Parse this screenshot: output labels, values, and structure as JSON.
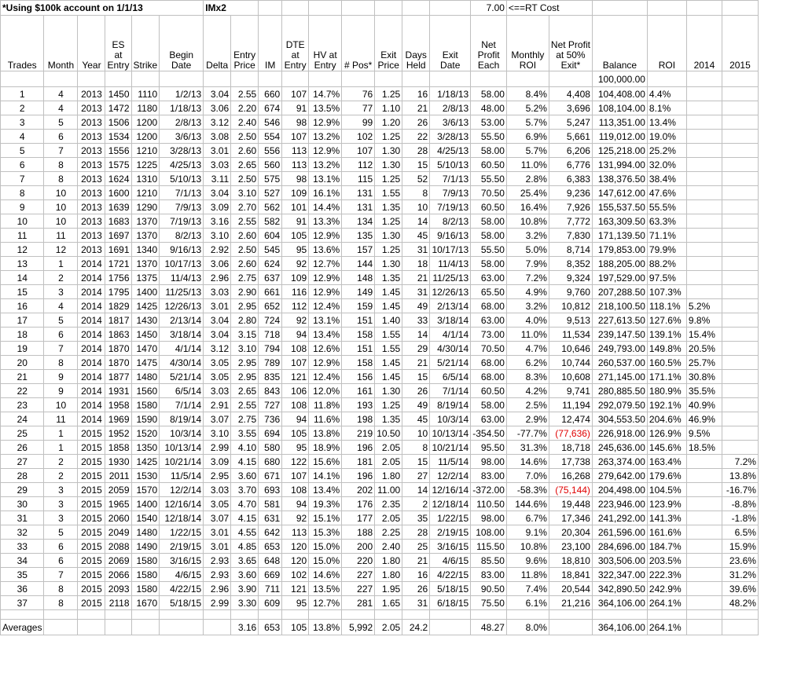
{
  "note": "*Using $100k account on 1/1/13",
  "im_note": "IMx2",
  "rt_cost": "7.00",
  "rt_cost_label": "<==RT Cost",
  "headers": [
    "Trades",
    "Month",
    "Year",
    "ES at Entry",
    "Strike",
    "Begin Date",
    "Delta",
    "Entry Price",
    "IM",
    "DTE at Entry",
    "HV at Entry",
    "# Pos*",
    "Exit Price",
    "Days Held",
    "Exit Date",
    "Net Profit Each",
    "Monthly ROI",
    "Net Profit at 50% Exit*",
    "Balance",
    "ROI",
    "2014",
    "2015"
  ],
  "starting_balance": "100,000.00",
  "rows": [
    [
      "1",
      "4",
      "2013",
      "1450",
      "1110",
      "1/2/13",
      "3.04",
      "2.55",
      "660",
      "107",
      "14.7%",
      "76",
      "1.25",
      "16",
      "1/18/13",
      "58.00",
      "8.4%",
      "4,408",
      "104,408.00",
      "4.4%",
      "",
      ""
    ],
    [
      "2",
      "4",
      "2013",
      "1472",
      "1180",
      "1/18/13",
      "3.06",
      "2.20",
      "674",
      "91",
      "13.5%",
      "77",
      "1.10",
      "21",
      "2/8/13",
      "48.00",
      "5.2%",
      "3,696",
      "108,104.00",
      "8.1%",
      "",
      ""
    ],
    [
      "3",
      "5",
      "2013",
      "1506",
      "1200",
      "2/8/13",
      "3.12",
      "2.40",
      "546",
      "98",
      "12.9%",
      "99",
      "1.20",
      "26",
      "3/6/13",
      "53.00",
      "5.7%",
      "5,247",
      "113,351.00",
      "13.4%",
      "",
      ""
    ],
    [
      "4",
      "6",
      "2013",
      "1534",
      "1200",
      "3/6/13",
      "3.08",
      "2.50",
      "554",
      "107",
      "13.2%",
      "102",
      "1.25",
      "22",
      "3/28/13",
      "55.50",
      "6.9%",
      "5,661",
      "119,012.00",
      "19.0%",
      "",
      ""
    ],
    [
      "5",
      "7",
      "2013",
      "1556",
      "1210",
      "3/28/13",
      "3.01",
      "2.60",
      "556",
      "113",
      "12.9%",
      "107",
      "1.30",
      "28",
      "4/25/13",
      "58.00",
      "5.7%",
      "6,206",
      "125,218.00",
      "25.2%",
      "",
      ""
    ],
    [
      "6",
      "8",
      "2013",
      "1575",
      "1225",
      "4/25/13",
      "3.03",
      "2.65",
      "560",
      "113",
      "13.2%",
      "112",
      "1.30",
      "15",
      "5/10/13",
      "60.50",
      "11.0%",
      "6,776",
      "131,994.00",
      "32.0%",
      "",
      ""
    ],
    [
      "7",
      "8",
      "2013",
      "1624",
      "1310",
      "5/10/13",
      "3.11",
      "2.50",
      "575",
      "98",
      "13.1%",
      "115",
      "1.25",
      "52",
      "7/1/13",
      "55.50",
      "2.8%",
      "6,383",
      "138,376.50",
      "38.4%",
      "",
      ""
    ],
    [
      "8",
      "10",
      "2013",
      "1600",
      "1210",
      "7/1/13",
      "3.04",
      "3.10",
      "527",
      "109",
      "16.1%",
      "131",
      "1.55",
      "8",
      "7/9/13",
      "70.50",
      "25.4%",
      "9,236",
      "147,612.00",
      "47.6%",
      "",
      ""
    ],
    [
      "9",
      "10",
      "2013",
      "1639",
      "1290",
      "7/9/13",
      "3.09",
      "2.70",
      "562",
      "101",
      "14.4%",
      "131",
      "1.35",
      "10",
      "7/19/13",
      "60.50",
      "16.4%",
      "7,926",
      "155,537.50",
      "55.5%",
      "",
      ""
    ],
    [
      "10",
      "10",
      "2013",
      "1683",
      "1370",
      "7/19/13",
      "3.16",
      "2.55",
      "582",
      "91",
      "13.3%",
      "134",
      "1.25",
      "14",
      "8/2/13",
      "58.00",
      "10.8%",
      "7,772",
      "163,309.50",
      "63.3%",
      "",
      ""
    ],
    [
      "11",
      "11",
      "2013",
      "1697",
      "1370",
      "8/2/13",
      "3.10",
      "2.60",
      "604",
      "105",
      "12.9%",
      "135",
      "1.30",
      "45",
      "9/16/13",
      "58.00",
      "3.2%",
      "7,830",
      "171,139.50",
      "71.1%",
      "",
      ""
    ],
    [
      "12",
      "12",
      "2013",
      "1691",
      "1340",
      "9/16/13",
      "2.92",
      "2.50",
      "545",
      "95",
      "13.6%",
      "157",
      "1.25",
      "31",
      "10/17/13",
      "55.50",
      "5.0%",
      "8,714",
      "179,853.00",
      "79.9%",
      "",
      ""
    ],
    [
      "13",
      "1",
      "2014",
      "1721",
      "1370",
      "10/17/13",
      "3.06",
      "2.60",
      "624",
      "92",
      "12.7%",
      "144",
      "1.30",
      "18",
      "11/4/13",
      "58.00",
      "7.9%",
      "8,352",
      "188,205.00",
      "88.2%",
      "",
      ""
    ],
    [
      "14",
      "2",
      "2014",
      "1756",
      "1375",
      "11/4/13",
      "2.96",
      "2.75",
      "637",
      "109",
      "12.9%",
      "148",
      "1.35",
      "21",
      "11/25/13",
      "63.00",
      "7.2%",
      "9,324",
      "197,529.00",
      "97.5%",
      "",
      ""
    ],
    [
      "15",
      "3",
      "2014",
      "1795",
      "1400",
      "11/25/13",
      "3.03",
      "2.90",
      "661",
      "116",
      "12.9%",
      "149",
      "1.45",
      "31",
      "12/26/13",
      "65.50",
      "4.9%",
      "9,760",
      "207,288.50",
      "107.3%",
      "",
      ""
    ],
    [
      "16",
      "4",
      "2014",
      "1829",
      "1425",
      "12/26/13",
      "3.01",
      "2.95",
      "652",
      "112",
      "12.4%",
      "159",
      "1.45",
      "49",
      "2/13/14",
      "68.00",
      "3.2%",
      "10,812",
      "218,100.50",
      "118.1%",
      "5.2%",
      ""
    ],
    [
      "17",
      "5",
      "2014",
      "1817",
      "1430",
      "2/13/14",
      "3.04",
      "2.80",
      "724",
      "92",
      "13.1%",
      "151",
      "1.40",
      "33",
      "3/18/14",
      "63.00",
      "4.0%",
      "9,513",
      "227,613.50",
      "127.6%",
      "9.8%",
      ""
    ],
    [
      "18",
      "6",
      "2014",
      "1863",
      "1450",
      "3/18/14",
      "3.04",
      "3.15",
      "718",
      "94",
      "13.4%",
      "158",
      "1.55",
      "14",
      "4/1/14",
      "73.00",
      "11.0%",
      "11,534",
      "239,147.50",
      "139.1%",
      "15.4%",
      ""
    ],
    [
      "19",
      "7",
      "2014",
      "1870",
      "1470",
      "4/1/14",
      "3.12",
      "3.10",
      "794",
      "108",
      "12.6%",
      "151",
      "1.55",
      "29",
      "4/30/14",
      "70.50",
      "4.7%",
      "10,646",
      "249,793.00",
      "149.8%",
      "20.5%",
      ""
    ],
    [
      "20",
      "8",
      "2014",
      "1870",
      "1475",
      "4/30/14",
      "3.05",
      "2.95",
      "789",
      "107",
      "12.9%",
      "158",
      "1.45",
      "21",
      "5/21/14",
      "68.00",
      "6.2%",
      "10,744",
      "260,537.00",
      "160.5%",
      "25.7%",
      ""
    ],
    [
      "21",
      "9",
      "2014",
      "1877",
      "1480",
      "5/21/14",
      "3.05",
      "2.95",
      "835",
      "121",
      "12.4%",
      "156",
      "1.45",
      "15",
      "6/5/14",
      "68.00",
      "8.3%",
      "10,608",
      "271,145.00",
      "171.1%",
      "30.8%",
      ""
    ],
    [
      "22",
      "9",
      "2014",
      "1931",
      "1560",
      "6/5/14",
      "3.03",
      "2.65",
      "843",
      "106",
      "12.0%",
      "161",
      "1.30",
      "26",
      "7/1/14",
      "60.50",
      "4.2%",
      "9,741",
      "280,885.50",
      "180.9%",
      "35.5%",
      ""
    ],
    [
      "23",
      "10",
      "2014",
      "1958",
      "1580",
      "7/1/14",
      "2.91",
      "2.55",
      "727",
      "108",
      "11.8%",
      "193",
      "1.25",
      "49",
      "8/19/14",
      "58.00",
      "2.5%",
      "11,194",
      "292,079.50",
      "192.1%",
      "40.9%",
      ""
    ],
    [
      "24",
      "11",
      "2014",
      "1969",
      "1590",
      "8/19/14",
      "3.07",
      "2.75",
      "736",
      "94",
      "11.6%",
      "198",
      "1.35",
      "45",
      "10/3/14",
      "63.00",
      "2.9%",
      "12,474",
      "304,553.50",
      "204.6%",
      "46.9%",
      ""
    ],
    [
      "25",
      "1",
      "2015",
      "1952",
      "1520",
      "10/3/14",
      "3.10",
      "3.55",
      "694",
      "105",
      "13.8%",
      "219",
      "10.50",
      "10",
      "10/13/14",
      "-354.50",
      "-77.7%",
      "(77,636)",
      "226,918.00",
      "126.9%",
      "9.5%",
      ""
    ],
    [
      "26",
      "1",
      "2015",
      "1858",
      "1350",
      "10/13/14",
      "2.99",
      "4.10",
      "580",
      "95",
      "18.9%",
      "196",
      "2.05",
      "8",
      "10/21/14",
      "95.50",
      "31.3%",
      "18,718",
      "245,636.00",
      "145.6%",
      "18.5%",
      ""
    ],
    [
      "27",
      "2",
      "2015",
      "1930",
      "1425",
      "10/21/14",
      "3.09",
      "4.15",
      "680",
      "122",
      "15.6%",
      "181",
      "2.05",
      "15",
      "11/5/14",
      "98.00",
      "14.6%",
      "17,738",
      "263,374.00",
      "163.4%",
      "",
      "7.2%"
    ],
    [
      "28",
      "2",
      "2015",
      "2011",
      "1530",
      "11/5/14",
      "2.95",
      "3.60",
      "671",
      "107",
      "14.1%",
      "196",
      "1.80",
      "27",
      "12/2/14",
      "83.00",
      "7.0%",
      "16,268",
      "279,642.00",
      "179.6%",
      "",
      "13.8%"
    ],
    [
      "29",
      "3",
      "2015",
      "2059",
      "1570",
      "12/2/14",
      "3.03",
      "3.70",
      "693",
      "108",
      "13.4%",
      "202",
      "11.00",
      "14",
      "12/16/14",
      "-372.00",
      "-58.3%",
      "(75,144)",
      "204,498.00",
      "104.5%",
      "",
      "-16.7%"
    ],
    [
      "30",
      "3",
      "2015",
      "1965",
      "1400",
      "12/16/14",
      "3.05",
      "4.70",
      "581",
      "94",
      "19.3%",
      "176",
      "2.35",
      "2",
      "12/18/14",
      "110.50",
      "144.6%",
      "19,448",
      "223,946.00",
      "123.9%",
      "",
      "-8.8%"
    ],
    [
      "31",
      "3",
      "2015",
      "2060",
      "1540",
      "12/18/14",
      "3.07",
      "4.15",
      "631",
      "92",
      "15.1%",
      "177",
      "2.05",
      "35",
      "1/22/15",
      "98.00",
      "6.7%",
      "17,346",
      "241,292.00",
      "141.3%",
      "",
      "-1.8%"
    ],
    [
      "32",
      "5",
      "2015",
      "2049",
      "1480",
      "1/22/15",
      "3.01",
      "4.55",
      "642",
      "113",
      "15.3%",
      "188",
      "2.25",
      "28",
      "2/19/15",
      "108.00",
      "9.1%",
      "20,304",
      "261,596.00",
      "161.6%",
      "",
      "6.5%"
    ],
    [
      "33",
      "6",
      "2015",
      "2088",
      "1490",
      "2/19/15",
      "3.01",
      "4.85",
      "653",
      "120",
      "15.0%",
      "200",
      "2.40",
      "25",
      "3/16/15",
      "115.50",
      "10.8%",
      "23,100",
      "284,696.00",
      "184.7%",
      "",
      "15.9%"
    ],
    [
      "34",
      "6",
      "2015",
      "2069",
      "1580",
      "3/16/15",
      "2.93",
      "3.65",
      "648",
      "120",
      "15.0%",
      "220",
      "1.80",
      "21",
      "4/6/15",
      "85.50",
      "9.6%",
      "18,810",
      "303,506.00",
      "203.5%",
      "",
      "23.6%"
    ],
    [
      "35",
      "7",
      "2015",
      "2066",
      "1580",
      "4/6/15",
      "2.93",
      "3.60",
      "669",
      "102",
      "14.6%",
      "227",
      "1.80",
      "16",
      "4/22/15",
      "83.00",
      "11.8%",
      "18,841",
      "322,347.00",
      "222.3%",
      "",
      "31.2%"
    ],
    [
      "36",
      "8",
      "2015",
      "2093",
      "1580",
      "4/22/15",
      "2.96",
      "3.90",
      "711",
      "121",
      "13.5%",
      "227",
      "1.95",
      "26",
      "5/18/15",
      "90.50",
      "7.4%",
      "20,544",
      "342,890.50",
      "242.9%",
      "",
      "39.6%"
    ],
    [
      "37",
      "8",
      "2015",
      "2118",
      "1670",
      "5/18/15",
      "2.99",
      "3.30",
      "609",
      "95",
      "12.7%",
      "281",
      "1.65",
      "31",
      "6/18/15",
      "75.50",
      "6.1%",
      "21,216",
      "364,106.00",
      "264.1%",
      "",
      "48.2%"
    ]
  ],
  "averages": {
    "label": "Averages",
    "entry_price": "3.16",
    "im": "653",
    "dte": "105",
    "hv": "13.8%",
    "pos": "5,992",
    "exit_price": "2.05",
    "days_held": "24.2",
    "net_profit_each": "48.27",
    "monthly_roi": "8.0%",
    "balance": "364,106.00",
    "roi": "264.1%"
  }
}
